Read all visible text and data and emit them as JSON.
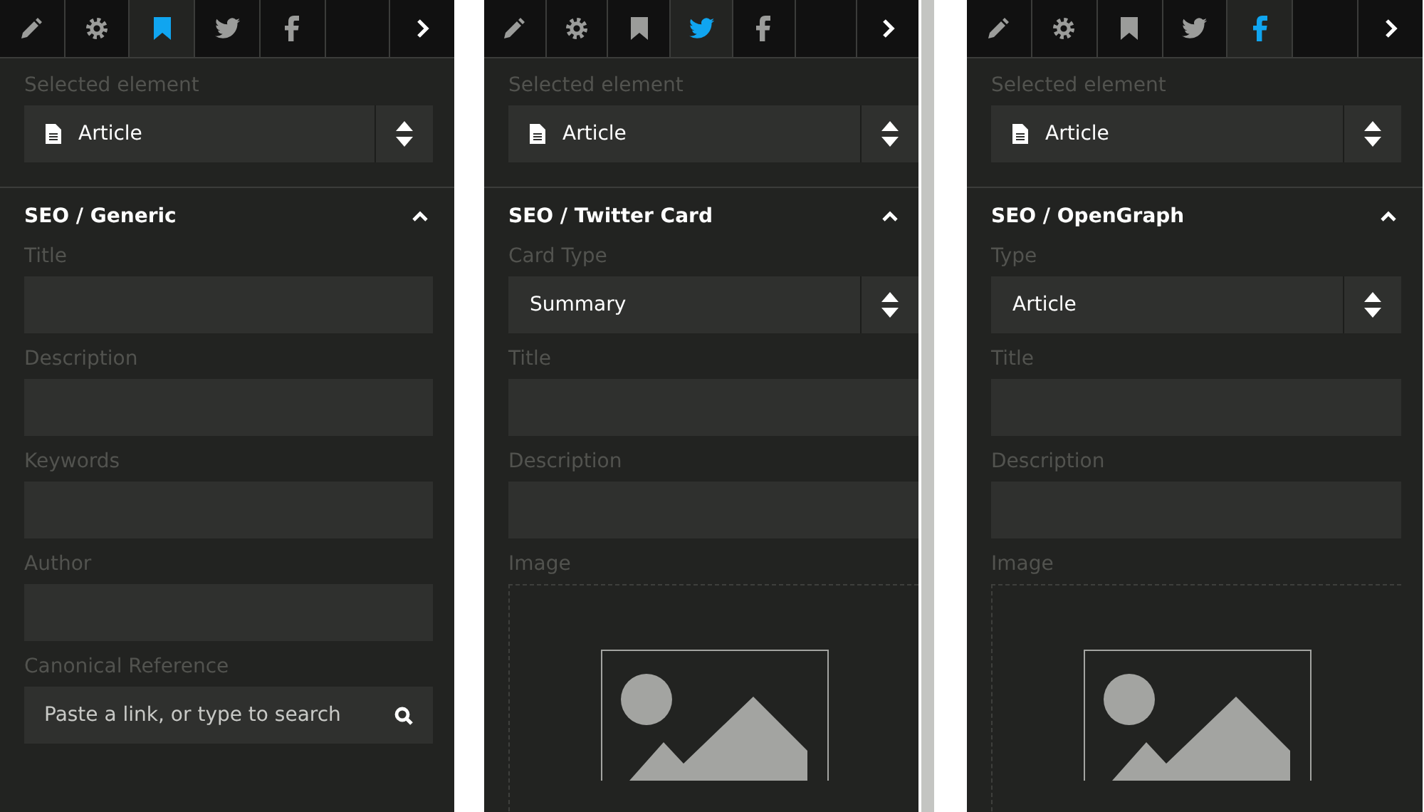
{
  "panels": [
    {
      "scrollable": false,
      "tabs": [
        {
          "kind": "pencil",
          "selected": false
        },
        {
          "kind": "gear",
          "selected": false
        },
        {
          "kind": "bookmark",
          "selected": true
        },
        {
          "kind": "twitter",
          "selected": false
        },
        {
          "kind": "facebook",
          "selected": false
        },
        {
          "kind": "blank",
          "selected": false
        },
        {
          "kind": "next",
          "selected": false
        }
      ],
      "selected_element": {
        "label": "Selected element",
        "value": "Article"
      },
      "section": {
        "title": "SEO / Generic",
        "expanded": true,
        "fields": [
          {
            "kind": "text",
            "label": "Title"
          },
          {
            "kind": "text",
            "label": "Description"
          },
          {
            "kind": "text",
            "label": "Keywords"
          },
          {
            "kind": "text",
            "label": "Author"
          },
          {
            "kind": "link",
            "label": "Canonical Reference",
            "placeholder": "Paste a link, or type to search"
          }
        ]
      }
    },
    {
      "scrollable": true,
      "tabs": [
        {
          "kind": "pencil",
          "selected": false
        },
        {
          "kind": "gear",
          "selected": false
        },
        {
          "kind": "bookmark",
          "selected": false
        },
        {
          "kind": "twitter",
          "selected": true
        },
        {
          "kind": "facebook",
          "selected": false
        },
        {
          "kind": "blank",
          "selected": false
        },
        {
          "kind": "next",
          "selected": false
        }
      ],
      "selected_element": {
        "label": "Selected element",
        "value": "Article"
      },
      "section": {
        "title": "SEO / Twitter Card",
        "expanded": true,
        "fields": [
          {
            "kind": "select",
            "label": "Card Type",
            "value": "Summary"
          },
          {
            "kind": "text",
            "label": "Title"
          },
          {
            "kind": "text",
            "label": "Description"
          },
          {
            "kind": "image",
            "label": "Image"
          }
        ]
      }
    },
    {
      "scrollable": false,
      "tabs": [
        {
          "kind": "pencil",
          "selected": false
        },
        {
          "kind": "gear",
          "selected": false
        },
        {
          "kind": "bookmark",
          "selected": false
        },
        {
          "kind": "twitter",
          "selected": false
        },
        {
          "kind": "facebook",
          "selected": true
        },
        {
          "kind": "blank",
          "selected": false
        },
        {
          "kind": "next",
          "selected": false
        }
      ],
      "selected_element": {
        "label": "Selected element",
        "value": "Article"
      },
      "section": {
        "title": "SEO / OpenGraph",
        "expanded": true,
        "fields": [
          {
            "kind": "select",
            "label": "Type",
            "value": "Article"
          },
          {
            "kind": "text",
            "label": "Title"
          },
          {
            "kind": "text",
            "label": "Description"
          },
          {
            "kind": "image",
            "label": "Image"
          }
        ]
      }
    }
  ]
}
